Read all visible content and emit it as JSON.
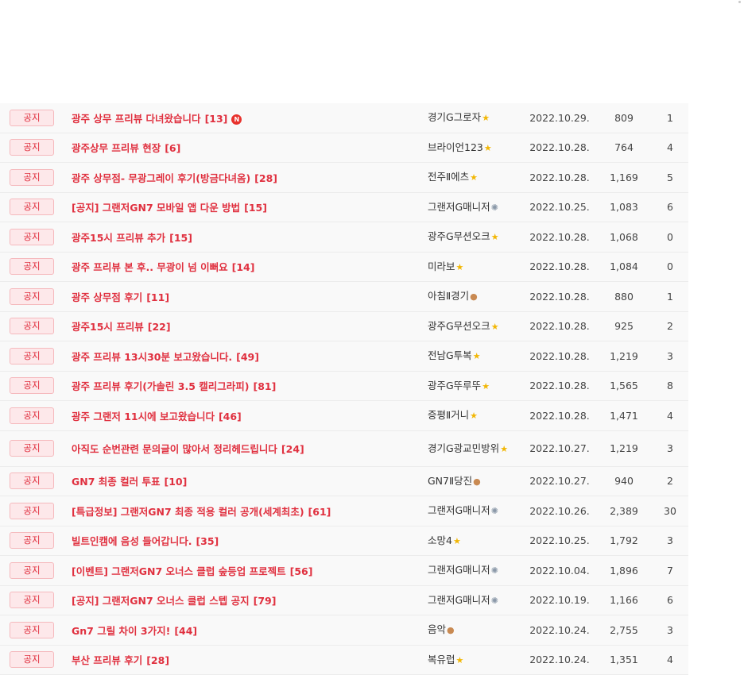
{
  "board": {
    "rows": [
      {
        "badge": "공지",
        "title": "광주 상무 프리뷰 다녀왔습니다",
        "comments": "[13]",
        "is_new": true,
        "new_label": "N",
        "author": "경기G그로자",
        "level_icon": "star-icon",
        "level_glyph": "★",
        "date": "2022.10.29.",
        "views": "809",
        "likes": "1"
      },
      {
        "badge": "공지",
        "title": "광주상무 프리뷰 현장",
        "comments": "[6]",
        "is_new": false,
        "author": "브라이언123",
        "level_icon": "star-icon",
        "level_glyph": "★",
        "date": "2022.10.28.",
        "views": "764",
        "likes": "4"
      },
      {
        "badge": "공지",
        "title": "광주 상무점- 무광그레이 후기(방금다녀옴)",
        "comments": "[28]",
        "is_new": false,
        "author": "전주Ⅱ에츠",
        "level_icon": "star-icon",
        "level_glyph": "★",
        "date": "2022.10.28.",
        "views": "1,169",
        "likes": "5"
      },
      {
        "badge": "공지",
        "title": "[공지] 그랜저GN7 모바일 앱 다운 방법",
        "comments": "[15]",
        "is_new": false,
        "author": "그랜저G매니저",
        "level_icon": "gear-icon",
        "level_glyph": "✺",
        "date": "2022.10.25.",
        "views": "1,083",
        "likes": "6"
      },
      {
        "badge": "공지",
        "title": "광주15시 프리뷰 추가",
        "comments": "[15]",
        "is_new": false,
        "author": "광주G무션오크",
        "level_icon": "star-icon",
        "level_glyph": "★",
        "date": "2022.10.28.",
        "views": "1,068",
        "likes": "0"
      },
      {
        "badge": "공지",
        "title": "광주 프리뷰 본 후.. 무광이 넘 이뻐요",
        "comments": "[14]",
        "is_new": false,
        "author": "미라보",
        "level_icon": "star-icon",
        "level_glyph": "★",
        "date": "2022.10.28.",
        "views": "1,084",
        "likes": "0"
      },
      {
        "badge": "공지",
        "title": "광주 상무점 후기",
        "comments": "[11]",
        "is_new": false,
        "author": "아침Ⅱ경기",
        "level_icon": "medal-icon",
        "level_glyph": "●",
        "date": "2022.10.28.",
        "views": "880",
        "likes": "1"
      },
      {
        "badge": "공지",
        "title": "광주15시 프리뷰",
        "comments": "[22]",
        "is_new": false,
        "author": "광주G무션오크",
        "level_icon": "star-icon",
        "level_glyph": "★",
        "date": "2022.10.28.",
        "views": "925",
        "likes": "2"
      },
      {
        "badge": "공지",
        "title": "광주 프리뷰 13시30분 보고왔습니다.",
        "comments": "[49]",
        "is_new": false,
        "author": "전남G투복",
        "level_icon": "star-icon",
        "level_glyph": "★",
        "date": "2022.10.28.",
        "views": "1,219",
        "likes": "3"
      },
      {
        "badge": "공지",
        "title": "광주 프리뷰 후기(가솔린 3.5 캘리그라피)",
        "comments": "[81]",
        "is_new": false,
        "author": "광주G뚜루뚜",
        "level_icon": "star-icon",
        "level_glyph": "★",
        "date": "2022.10.28.",
        "views": "1,565",
        "likes": "8"
      },
      {
        "badge": "공지",
        "title": "광주 그랜저 11시에 보고왔습니다",
        "comments": "[46]",
        "is_new": false,
        "author": "증평Ⅱ거니",
        "level_icon": "star-icon",
        "level_glyph": "★",
        "date": "2022.10.28.",
        "views": "1,471",
        "likes": "4"
      },
      {
        "badge": "공지",
        "title": "아직도 순번관련 문의글이 많아서 정리헤드립니다",
        "comments": "[24]",
        "is_new": false,
        "tall": true,
        "author": "경기G광교민방위",
        "level_icon": "star-icon",
        "level_glyph": "★",
        "date": "2022.10.27.",
        "views": "1,219",
        "likes": "3"
      },
      {
        "badge": "공지",
        "title": "GN7 최종 컬러 투표",
        "comments": "[10]",
        "is_new": false,
        "author": "GN7Ⅱ당진",
        "level_icon": "medal-icon",
        "level_glyph": "●",
        "date": "2022.10.27.",
        "views": "940",
        "likes": "2"
      },
      {
        "badge": "공지",
        "title": "[특급정보] 그랜저GN7 최종 적용 컬러 공개(세계최초)",
        "comments": "[61]",
        "is_new": false,
        "author": "그랜저G매니저",
        "level_icon": "gear-icon",
        "level_glyph": "✺",
        "date": "2022.10.26.",
        "views": "2,389",
        "likes": "30"
      },
      {
        "badge": "공지",
        "title": "빌트인캠에 음성 들어갑니다.",
        "comments": "[35]",
        "is_new": false,
        "author": "소망4",
        "level_icon": "star-icon",
        "level_glyph": "★",
        "date": "2022.10.25.",
        "views": "1,792",
        "likes": "3"
      },
      {
        "badge": "공지",
        "title": "[이벤트] 그랜저GN7 오너스 클럽 숲등업 프로젝트",
        "comments": "[56]",
        "is_new": false,
        "author": "그랜저G매니저",
        "level_icon": "gear-icon",
        "level_glyph": "✺",
        "date": "2022.10.04.",
        "views": "1,896",
        "likes": "7"
      },
      {
        "badge": "공지",
        "title": "[공지] 그랜저GN7 오너스 클럽 스텝 공지",
        "comments": "[79]",
        "is_new": false,
        "author": "그랜저G매니저",
        "level_icon": "gear-icon",
        "level_glyph": "✺",
        "date": "2022.10.19.",
        "views": "1,166",
        "likes": "6"
      },
      {
        "badge": "공지",
        "title": "Gn7 그릴 차이 3가지!",
        "comments": "[44]",
        "is_new": false,
        "author": "음악",
        "level_icon": "medal-icon",
        "level_glyph": "●",
        "date": "2022.10.24.",
        "views": "2,755",
        "likes": "3"
      },
      {
        "badge": "공지",
        "title": "부산 프리뷰 후기",
        "comments": "[28]",
        "is_new": false,
        "author": "복유럽",
        "level_icon": "star-icon",
        "level_glyph": "★",
        "date": "2022.10.24.",
        "views": "1,351",
        "likes": "4"
      }
    ]
  }
}
